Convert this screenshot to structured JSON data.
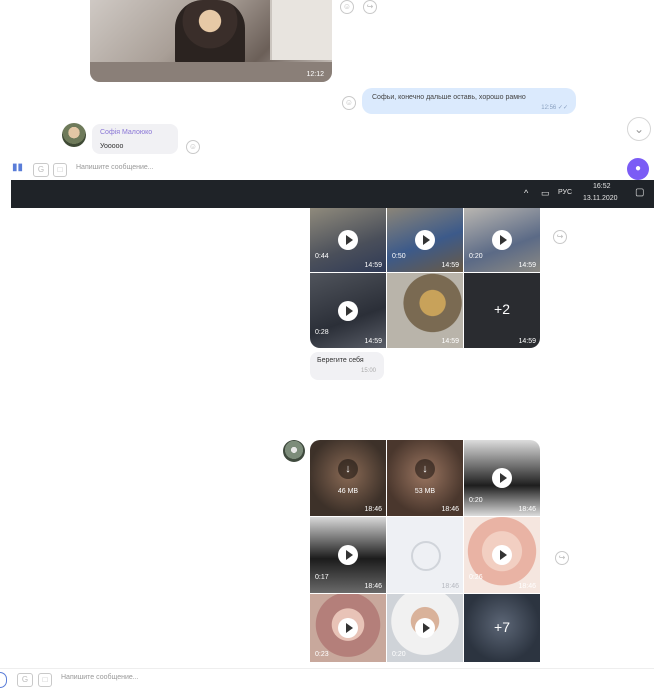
{
  "top_chat": {
    "video_time": "12:12",
    "outgoing_text": "Софьи, конечно дальше оставь, хорошо рамно",
    "outgoing_time": "12:56 ✓✓",
    "sender_name": "Софія Малоюко",
    "sender_preview": "Уооооо"
  },
  "compose_top": {
    "placeholder": "Напишите сообщение..."
  },
  "taskbar": {
    "lang": "РУС",
    "time": "16:52",
    "date": "13.11.2020"
  },
  "grid1": {
    "cells": [
      {
        "duration": "0:44",
        "time": "14:59"
      },
      {
        "duration": "0:50",
        "time": "14:59"
      },
      {
        "duration": "0:20",
        "time": "14:59"
      },
      {
        "duration": "0:28",
        "time": "14:59"
      },
      {
        "duration": "",
        "time": "14:59"
      },
      {
        "more": "+2",
        "time": "14:59"
      }
    ]
  },
  "caption": {
    "text": "Берегите себя",
    "time": "15:00"
  },
  "grid2": {
    "cells": [
      {
        "size": "46 MB",
        "time": "18:46"
      },
      {
        "size": "53 MB",
        "time": "18:46"
      },
      {
        "duration": "0:20",
        "time": "18:46"
      },
      {
        "duration": "0:17",
        "time": "18:46"
      },
      {
        "time": "18:46"
      },
      {
        "duration": "0:26",
        "time": "18:46"
      },
      {
        "duration": "0:23"
      },
      {
        "duration": "0:20"
      },
      {
        "more": "+7"
      }
    ]
  },
  "compose_bottom": {
    "placeholder": "Напишите сообщение..."
  },
  "colors": {
    "accent": "#7b5cf5",
    "outgoing_bubble": "#dbeafd",
    "taskbar": "#1f2328"
  }
}
